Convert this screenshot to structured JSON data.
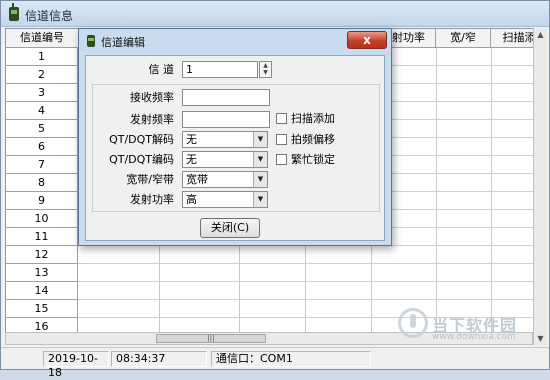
{
  "window": {
    "title": "信道信息"
  },
  "grid": {
    "columns": [
      "信道编号",
      "",
      "",
      "",
      "",
      "发射功率",
      "宽/窄",
      "扫描添"
    ],
    "rows": [
      "1",
      "2",
      "3",
      "4",
      "5",
      "6",
      "7",
      "8",
      "9",
      "10",
      "11",
      "12",
      "13",
      "14",
      "15",
      "16"
    ]
  },
  "status": {
    "date": "2019-10-18",
    "time": "08:34:37",
    "port": "通信口：COM1"
  },
  "dialog": {
    "title": "信道编辑",
    "close_label": "x",
    "channel_label": "信 道",
    "channel_value": "1",
    "rx_freq_label": "接收频率",
    "rx_freq_value": "",
    "tx_freq_label": "发射频率",
    "tx_freq_value": "",
    "qt_decode_label": "QT/DQT解码",
    "qt_decode_value": "无",
    "qt_encode_label": "QT/DQT编码",
    "qt_encode_value": "无",
    "bandwidth_label": "宽带/窄带",
    "bandwidth_value": "宽带",
    "power_label": "发射功率",
    "power_value": "高",
    "scan_add_label": "扫描添加",
    "freq_shift_label": "拍频偏移",
    "busy_lock_label": "繁忙锁定",
    "close_button_label": "关闭(C)"
  },
  "watermark": {
    "text": "当下软件园",
    "url": "www.downxia.com"
  }
}
